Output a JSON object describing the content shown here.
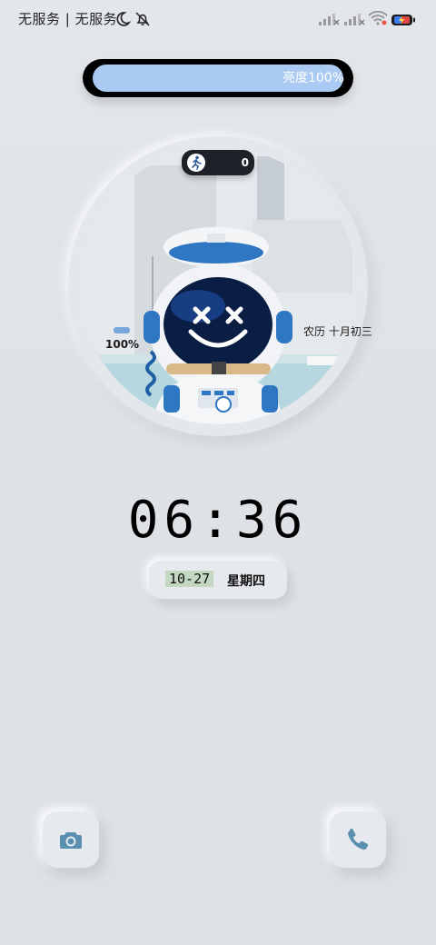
{
  "statusbar": {
    "carrier": "无服务 | 无服务",
    "icons": [
      "moon-icon",
      "bell-off-icon",
      "signal-no-service-icon",
      "signal-no-service-icon",
      "wifi-icon",
      "battery-charging-icon"
    ]
  },
  "brightness": {
    "label": "亮度100%",
    "level_percent": 100,
    "accent": "#abcaf3"
  },
  "widget": {
    "steps": "0",
    "steps_icon": "running-person-icon",
    "battery_percent": "100%",
    "lunar_date": "农历 十月初三"
  },
  "clock": {
    "time": "06:36",
    "date": "10-27",
    "weekday": "星期四"
  },
  "shortcuts": {
    "left": "camera-icon",
    "right": "phone-icon",
    "icon_color": "#5b8fb0"
  }
}
